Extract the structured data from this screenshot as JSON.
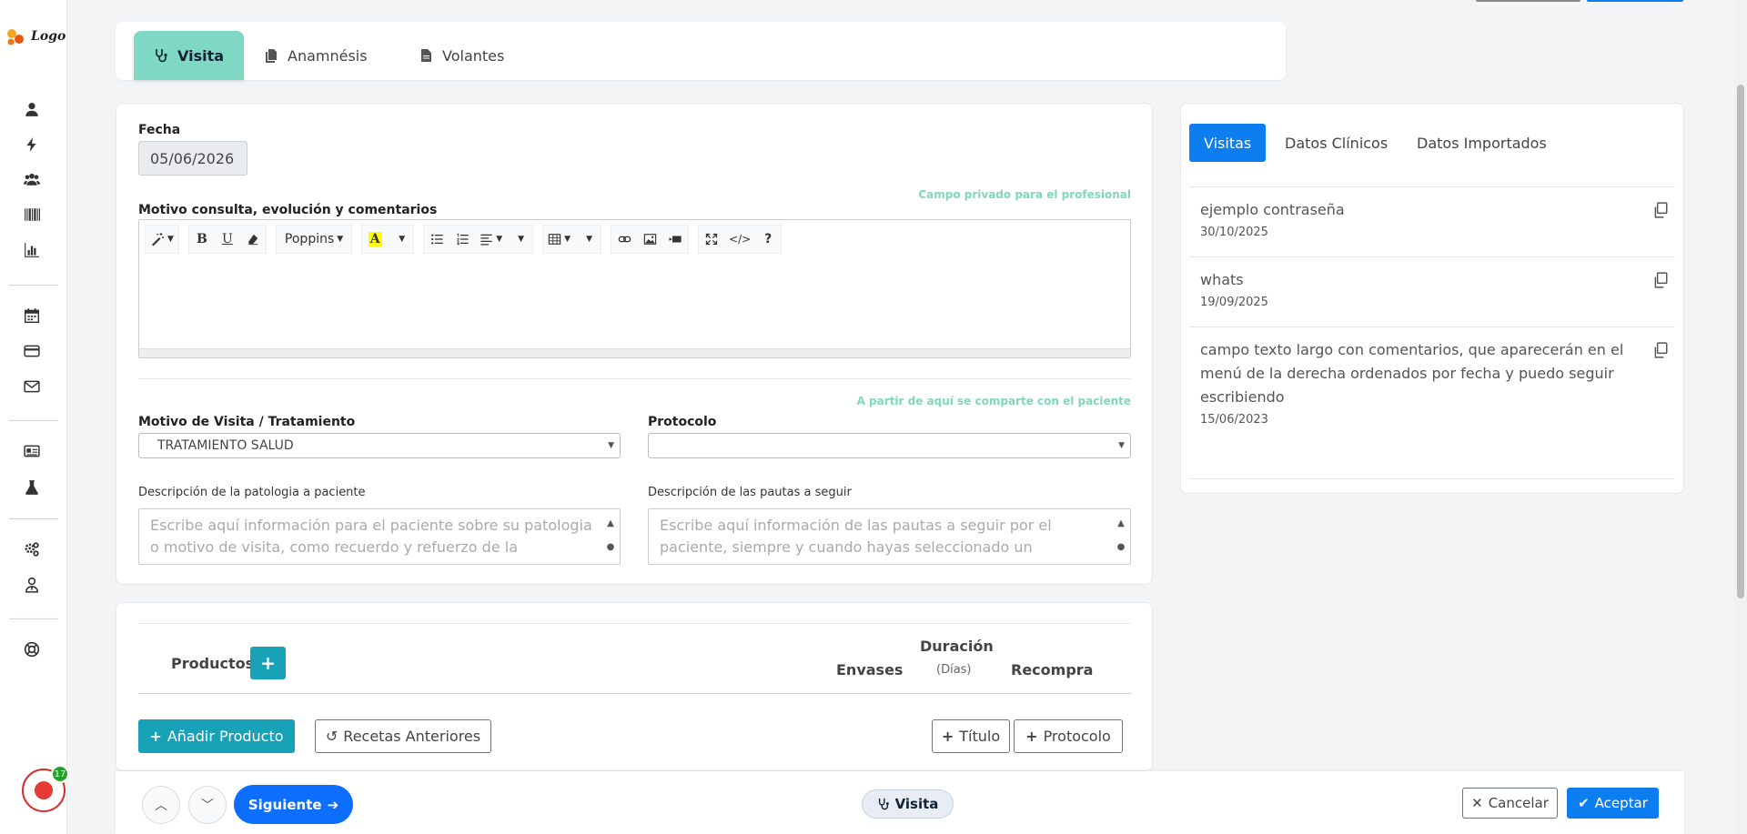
{
  "logo": {
    "text": "Logo"
  },
  "sidebar": {
    "items": [
      {
        "icon": "user-icon"
      },
      {
        "icon": "bolt-icon"
      },
      {
        "icon": "users-icon"
      },
      {
        "icon": "barcode-icon"
      },
      {
        "icon": "bar-chart-icon"
      },
      {
        "icon": "calendar-icon"
      },
      {
        "icon": "credit-card-icon"
      },
      {
        "icon": "envelope-icon"
      },
      {
        "icon": "id-card-icon"
      },
      {
        "icon": "flask-icon"
      },
      {
        "icon": "gears-icon"
      },
      {
        "icon": "user-md-icon"
      },
      {
        "icon": "life-ring-icon"
      }
    ],
    "notifications": "17"
  },
  "tabs": [
    {
      "label": "Visita",
      "icon": "stethoscope-icon",
      "active": true
    },
    {
      "label": "Anamnésis",
      "icon": "copy-icon",
      "active": false
    },
    {
      "label": "Volantes",
      "icon": "file-icon",
      "active": false
    }
  ],
  "visit": {
    "fecha_label": "Fecha",
    "fecha_value": "05/06/2026",
    "private_note": "Campo privado para el profesional",
    "motivo_label": "Motivo consulta, evolución y comentarios",
    "editor": {
      "font": "Poppins"
    },
    "shared_note": "A partir de aquí se comparte con el paciente",
    "motivo_visita_label": "Motivo de Visita / Tratamiento",
    "motivo_visita_value": "TRATAMIENTO SALUD",
    "protocolo_label": "Protocolo",
    "protocolo_value": "",
    "patologia_label": "Descripción de la patologia a paciente",
    "patologia_placeholder": "Escribe aquí información para el paciente sobre su patologia o motivo de visita, como recuerdo y refuerzo de la",
    "pautas_label": "Descripción de las pautas a seguir",
    "pautas_placeholder": "Escribe aquí información de las pautas a seguir por el paciente, siempre y cuando hayas seleccionado un"
  },
  "products": {
    "title": "Productos",
    "col_envases": "Envases",
    "col_duracion": "Duración",
    "col_dias": "(Días)",
    "col_recompra": "Recompra",
    "add_product": "Añadir Producto",
    "recetas": "Recetas Anteriores",
    "titulo": "Título",
    "protocolo": "Protocolo"
  },
  "right": {
    "tabs": [
      {
        "label": "Visitas",
        "active": true
      },
      {
        "label": "Datos Clínicos",
        "active": false
      },
      {
        "label": "Datos Importados",
        "active": false
      }
    ],
    "items": [
      {
        "title": "ejemplo contraseña",
        "date": "30/10/2025"
      },
      {
        "title": "whats",
        "date": "19/09/2025"
      },
      {
        "title": "campo texto largo con comentarios, que aparecerán en el menú de la derecha ordenados por fecha y puedo seguir escribiendo",
        "date": "15/06/2023"
      }
    ]
  },
  "bottom": {
    "siguiente": "Siguiente",
    "visita": "Visita",
    "cancelar": "Cancelar",
    "aceptar": "Aceptar"
  },
  "colors": {
    "accent": "#7fd8c4",
    "primary": "#0d7ef0",
    "teal": "#17a2b8",
    "record": "#e53935"
  }
}
